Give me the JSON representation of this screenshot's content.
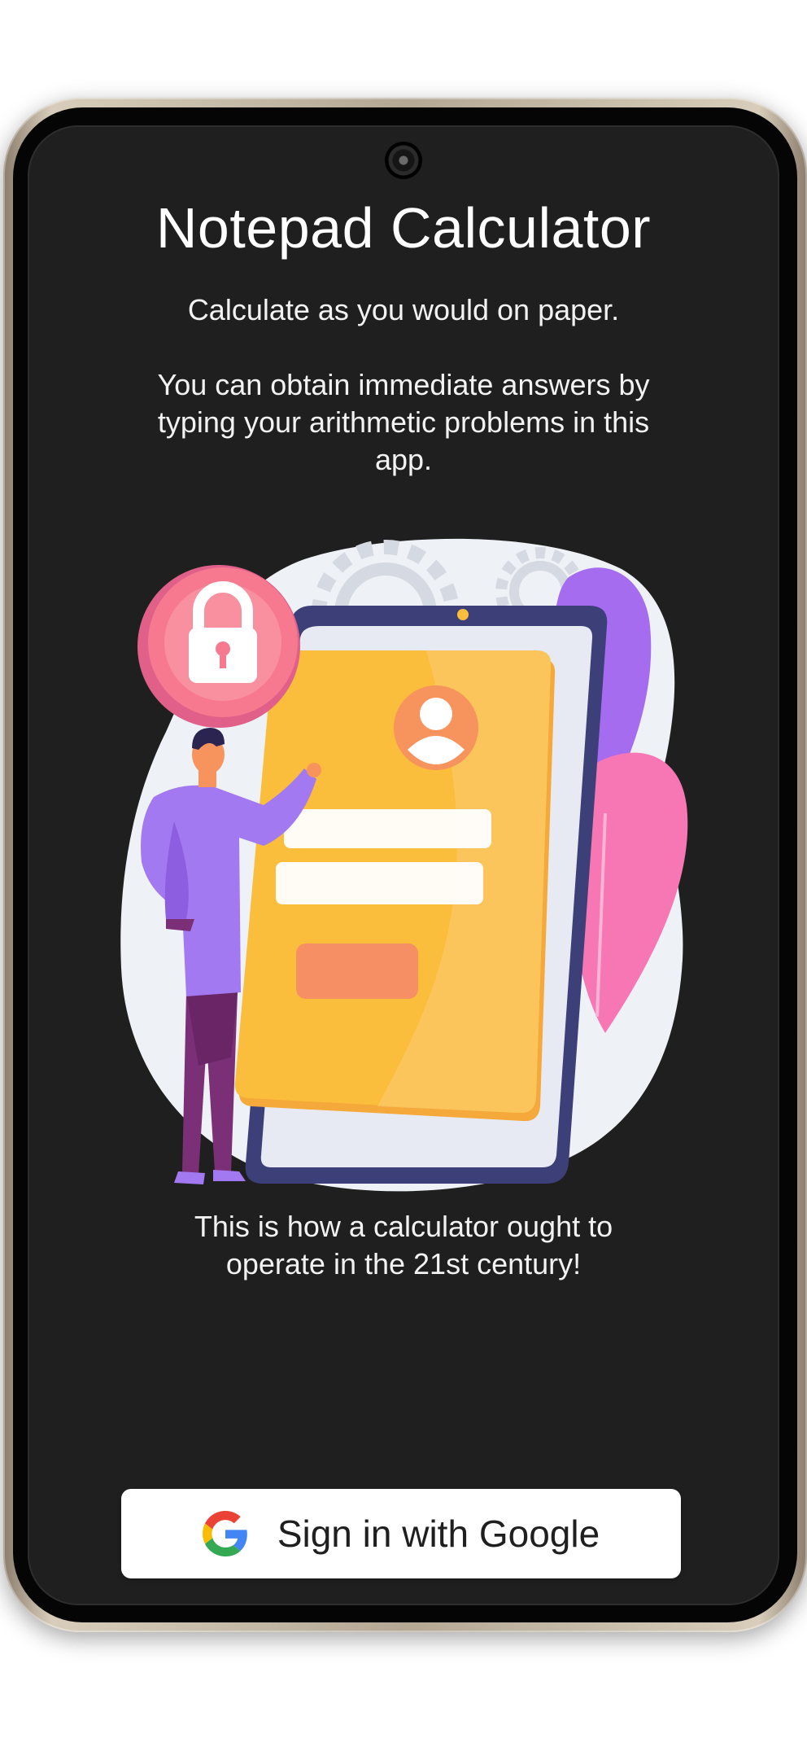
{
  "app": {
    "title": "Notepad Calculator",
    "subtitle": "Calculate as you would on paper.",
    "description": "You can obtain immediate answers by typing your arithmetic problems in this app.",
    "tagline": "This is how a calculator ought to operate in the 21st century!"
  },
  "signin": {
    "label": "Sign in with Google",
    "icon": "google-g-icon"
  },
  "illustration": {
    "icon": "login-illustration",
    "colors": {
      "blob": "#eef1f6",
      "card": "#fbbd3c",
      "lock_badge": "#f7798f",
      "person_shirt": "#a279f0",
      "leaf_pink": "#f776b4",
      "leaf_purple": "#a56cf0"
    }
  },
  "colors": {
    "screen_bg": "#1f1f1f",
    "text": "#ffffff",
    "button_bg": "#ffffff"
  }
}
